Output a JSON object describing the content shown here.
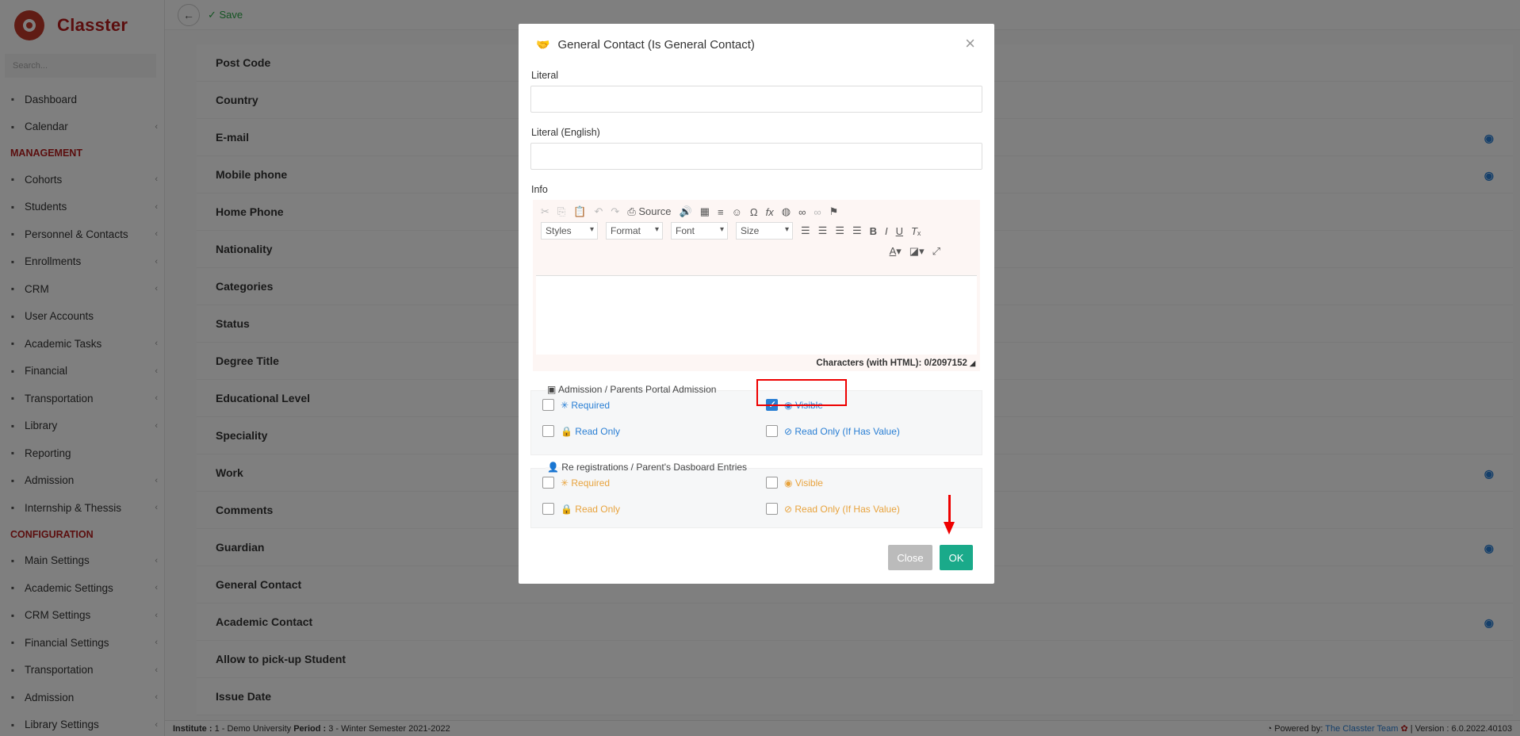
{
  "app": {
    "name": "Classter",
    "search_placeholder": "Search..."
  },
  "sidebar": {
    "items_top": [
      {
        "label": "Dashboard",
        "icon": "laptop-icon",
        "chevron": false
      },
      {
        "label": "Calendar",
        "icon": "calendar-icon",
        "chevron": true
      }
    ],
    "section_management": "MANAGEMENT",
    "items_management": [
      {
        "label": "Cohorts",
        "icon": "cohorts-icon",
        "chevron": true
      },
      {
        "label": "Students",
        "icon": "students-icon",
        "chevron": true
      },
      {
        "label": "Personnel & Contacts",
        "icon": "personnel-icon",
        "chevron": true
      },
      {
        "label": "Enrollments",
        "icon": "enrollments-icon",
        "chevron": true
      },
      {
        "label": "CRM",
        "icon": "crm-icon",
        "chevron": true
      },
      {
        "label": "User Accounts",
        "icon": "user-accounts-icon",
        "chevron": false
      },
      {
        "label": "Academic Tasks",
        "icon": "academic-tasks-icon",
        "chevron": true
      },
      {
        "label": "Financial",
        "icon": "financial-icon",
        "chevron": true
      },
      {
        "label": "Transportation",
        "icon": "bus-icon",
        "chevron": true
      },
      {
        "label": "Library",
        "icon": "library-icon",
        "chevron": true
      },
      {
        "label": "Reporting",
        "icon": "printer-icon",
        "chevron": false
      },
      {
        "label": "Admission",
        "icon": "institution-icon",
        "chevron": true
      },
      {
        "label": "Internship & Thessis",
        "icon": "internship-icon",
        "chevron": true
      }
    ],
    "section_configuration": "CONFIGURATION",
    "items_configuration": [
      {
        "label": "Main Settings",
        "icon": "sliders-icon",
        "chevron": true
      },
      {
        "label": "Academic Settings",
        "icon": "academic-settings-icon",
        "chevron": true
      },
      {
        "label": "CRM Settings",
        "icon": "crm-settings-icon",
        "chevron": true
      },
      {
        "label": "Financial Settings",
        "icon": "financial-settings-icon",
        "chevron": true
      },
      {
        "label": "Transportation",
        "icon": "bus-icon",
        "chevron": true
      },
      {
        "label": "Admission",
        "icon": "institution-icon",
        "chevron": true
      },
      {
        "label": "Library Settings",
        "icon": "library-icon",
        "chevron": true
      }
    ]
  },
  "toolbar": {
    "save_label": "Save"
  },
  "fields": [
    {
      "label": "Post Code",
      "eye": false
    },
    {
      "label": "Country",
      "eye": false
    },
    {
      "label": "E-mail",
      "eye": true
    },
    {
      "label": "Mobile phone",
      "eye": true
    },
    {
      "label": "Home Phone",
      "eye": false
    },
    {
      "label": "Nationality",
      "eye": false
    },
    {
      "label": "Categories",
      "eye": false
    },
    {
      "label": "Status",
      "eye": false
    },
    {
      "label": "Degree Title",
      "eye": false
    },
    {
      "label": "Educational Level",
      "eye": false
    },
    {
      "label": "Speciality",
      "eye": false
    },
    {
      "label": "Work",
      "eye": true
    },
    {
      "label": "Comments",
      "eye": false
    },
    {
      "label": "Guardian",
      "eye": true
    },
    {
      "label": "General Contact",
      "eye": false
    },
    {
      "label": "Academic Contact",
      "eye": true
    },
    {
      "label": "Allow to pick-up Student",
      "eye": false
    },
    {
      "label": "Issue Date",
      "eye": false
    }
  ],
  "footer": {
    "institute_label": "Institute :",
    "institute_value": "1 - Demo University",
    "period_label": "Period :",
    "period_value": "3 - Winter Semester 2021-2022",
    "powered_by": "Powered by:",
    "team": "The Classter Team",
    "version": "| Version : 6.0.2022.40103"
  },
  "modal": {
    "title": "General Contact (Is General Contact)",
    "literal_label": "Literal",
    "literal_value": "",
    "literal_en_label": "Literal (English)",
    "literal_en_value": "",
    "info_label": "Info",
    "editor": {
      "source_label": "Source",
      "styles": "Styles",
      "format": "Format",
      "font": "Font",
      "size": "Size",
      "char_count": "Characters (with HTML): 0/2097152"
    },
    "group1": {
      "legend": "Admission / Parents Portal Admission",
      "required": "Required",
      "visible": "Visible",
      "read_only": "Read Only",
      "read_only_if": "Read Only (If Has Value)",
      "required_checked": false,
      "visible_checked": true,
      "read_only_checked": false,
      "read_only_if_checked": false
    },
    "group2": {
      "legend": "Re registrations / Parent's Dasboard Entries",
      "required": "Required",
      "visible": "Visible",
      "read_only": "Read Only",
      "read_only_if": "Read Only (If Has Value)"
    },
    "close_label": "Close",
    "ok_label": "OK"
  },
  "colors": {
    "brand": "#b71c1c",
    "link": "#2a7fd4",
    "ok": "#1aaa8a",
    "warning": "#e8a33d",
    "highlight": "#ee0000"
  }
}
